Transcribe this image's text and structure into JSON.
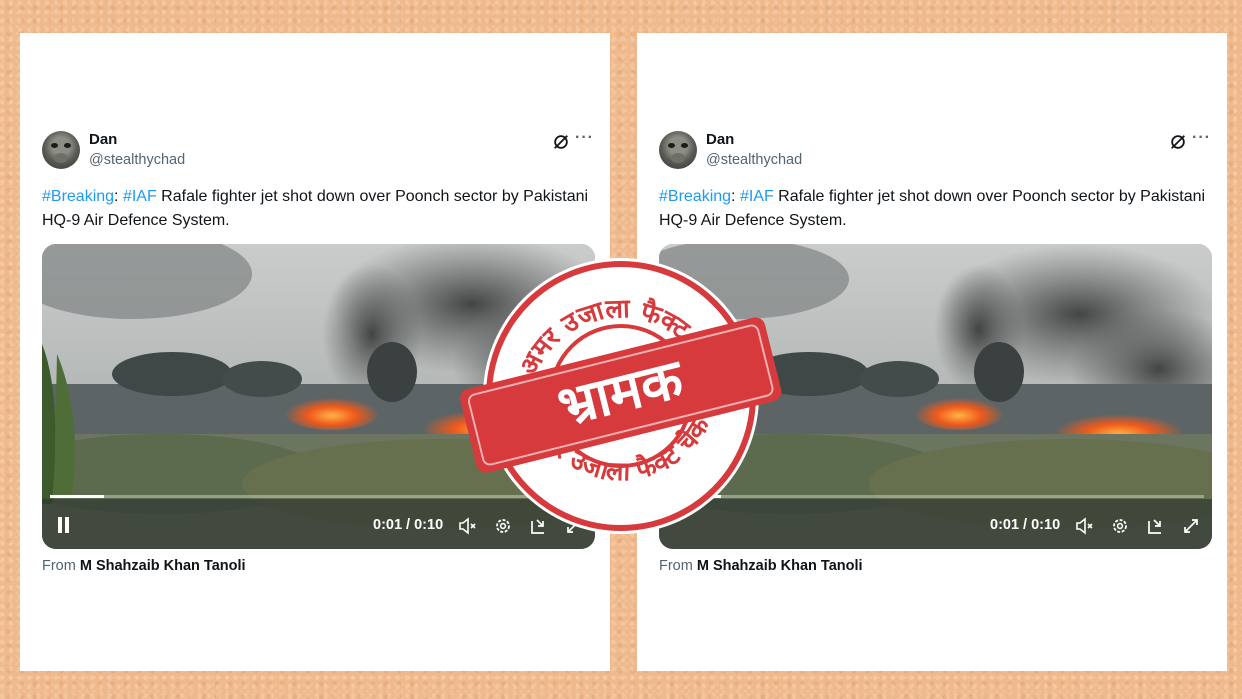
{
  "posts": [
    {
      "user_name": "Dan",
      "handle": "@stealthychad",
      "text_tag1": "#Breaking",
      "text_sep1": ": ",
      "text_tag2": "#IAF",
      "text_body": " Rafale fighter jet shot down over Poonch sector by Pakistani HQ-9 Air Defence System.",
      "video_time": "0:01 / 0:10",
      "video_progress": 0.1,
      "source_prefix": "From ",
      "source_name": "M Shahzaib Khan Tanoli"
    },
    {
      "user_name": "Dan",
      "handle": "@stealthychad",
      "text_tag1": "#Breaking",
      "text_sep1": ": ",
      "text_tag2": "#IAF",
      "text_body": " Rafale fighter jet shot down over Poonch sector by Pakistani HQ-9 Air Defence System.",
      "video_time": "0:01 / 0:10",
      "video_progress": 0.1,
      "source_prefix": "From ",
      "source_name": "M Shahzaib Khan Tanoli"
    }
  ],
  "stamp": {
    "label": "भ्रामक",
    "ring_text": "अमर उजाला फैक्ट चेक",
    "color": "#d63a3c"
  },
  "colors": {
    "background": "#efb98c",
    "link": "#1d9bf0",
    "handle": "#536471"
  },
  "icons": {
    "avatar": "avatar-image",
    "grok": "grok-icon",
    "more": "more-icon",
    "pause": "pause-icon",
    "mute": "mute-icon",
    "settings": "settings-icon",
    "pip": "pip-icon",
    "fullscreen": "fullscreen-icon"
  }
}
